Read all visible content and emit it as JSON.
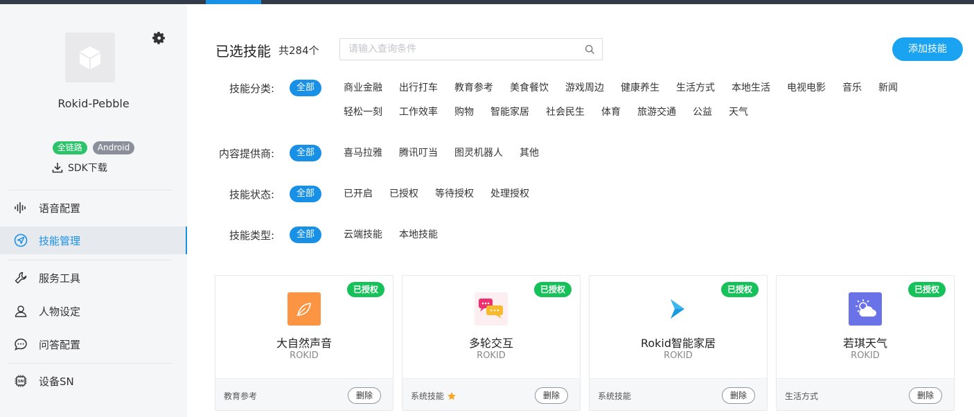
{
  "sidebar": {
    "device_name": "Rokid-Pebble",
    "tags": [
      "全链路",
      "Android"
    ],
    "sdk_download": "SDK下载",
    "nav": [
      {
        "label": "语音配置",
        "icon": "voice-wave-icon"
      },
      {
        "label": "技能管理",
        "icon": "send-icon",
        "active": true
      },
      {
        "label": "服务工具",
        "icon": "wrench-icon"
      },
      {
        "label": "人物设定",
        "icon": "person-icon"
      },
      {
        "label": "问答配置",
        "icon": "chat-icon"
      },
      {
        "label": "设备SN",
        "icon": "chip-icon"
      }
    ]
  },
  "header": {
    "title": "已选技能",
    "count": "共284个",
    "search_placeholder": "请输入查询条件",
    "add_button": "添加技能"
  },
  "filters": {
    "category": {
      "label": "技能分类:",
      "selected": "全部",
      "options": [
        "商业金融",
        "出行打车",
        "教育参考",
        "美食餐饮",
        "游戏周边",
        "健康养生",
        "生活方式",
        "本地生活",
        "电视电影",
        "音乐",
        "新闻",
        "轻松一刻",
        "工作效率",
        "购物",
        "智能家居",
        "社会民生",
        "体育",
        "旅游交通",
        "公益",
        "天气"
      ]
    },
    "provider": {
      "label": "内容提供商:",
      "selected": "全部",
      "options": [
        "喜马拉雅",
        "腾讯叮当",
        "图灵机器人",
        "其他"
      ]
    },
    "status": {
      "label": "技能状态:",
      "selected": "全部",
      "options": [
        "已开启",
        "已授权",
        "等待授权",
        "处理授权"
      ]
    },
    "type": {
      "label": "技能类型:",
      "selected": "全部",
      "options": [
        "云端技能",
        "本地技能"
      ]
    }
  },
  "cards": [
    {
      "badge": "已授权",
      "name": "大自然声音",
      "vendor": "ROKID",
      "category": "教育参考",
      "delete": "删除",
      "logo_color": "#fb9544"
    },
    {
      "badge": "已授权",
      "name": "多轮交互",
      "vendor": "ROKID",
      "category": "系统技能",
      "delete": "删除",
      "starred": true
    },
    {
      "badge": "已授权",
      "name": "Rokid智能家居",
      "vendor": "ROKID",
      "category": "系统技能",
      "delete": "删除"
    },
    {
      "badge": "已授权",
      "name": "若琪天气",
      "vendor": "ROKID",
      "category": "生活方式",
      "delete": "删除",
      "logo_color": "#6a72e8"
    }
  ],
  "colors": {
    "accent": "#1890e6",
    "authorized": "#17c15a",
    "sidebar_bg": "#f5f6f8"
  }
}
